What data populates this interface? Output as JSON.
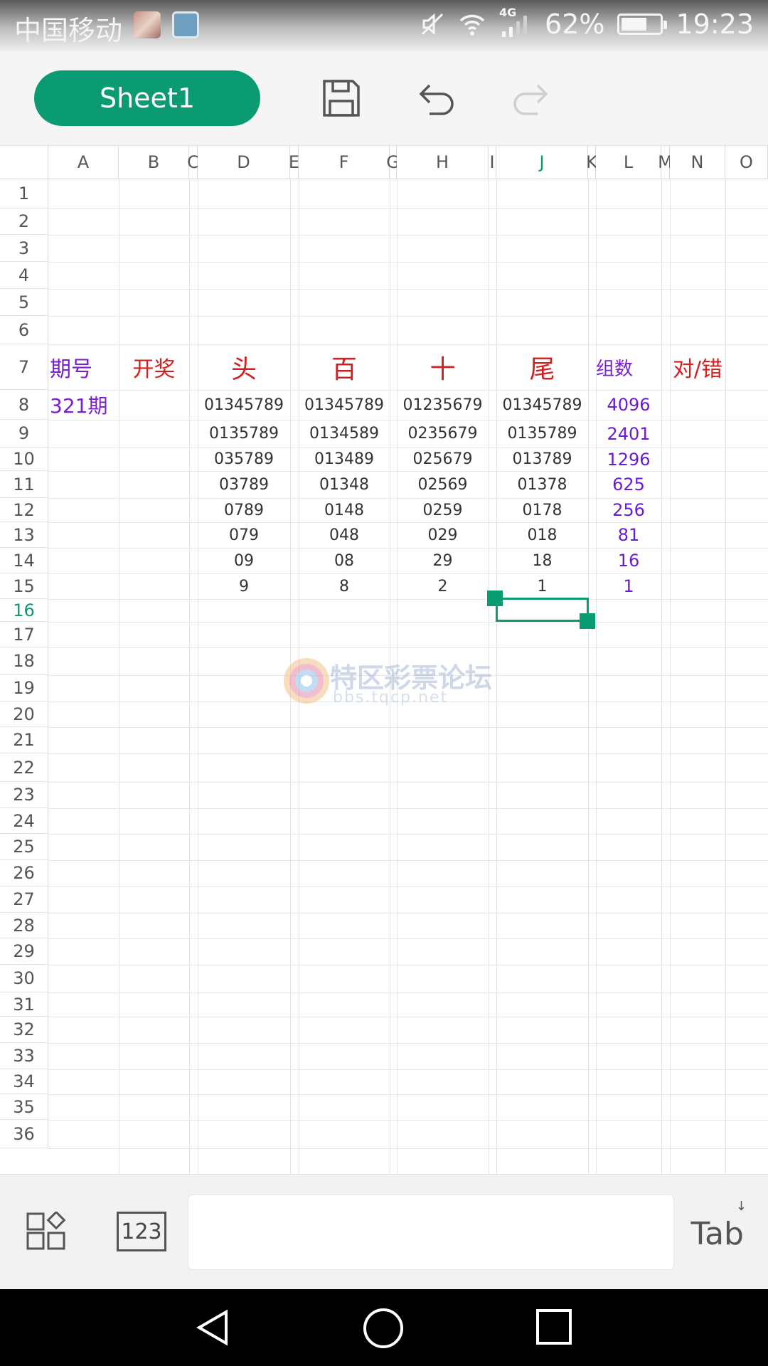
{
  "status": {
    "carrier": "中国移动",
    "network": "4G",
    "battery": "62%",
    "time": "19:23"
  },
  "toolbar": {
    "sheet_label": "Sheet1",
    "save_icon": "save-icon",
    "undo_icon": "undo-icon",
    "redo_icon": "redo-icon"
  },
  "columns": [
    "A",
    "B",
    "C",
    "D",
    "E",
    "F",
    "G",
    "H",
    "I",
    "J",
    "K",
    "L",
    "M",
    "N",
    "O"
  ],
  "selected_column": "J",
  "rows": [
    "1",
    "2",
    "3",
    "4",
    "5",
    "6",
    "7",
    "8",
    "9",
    "10",
    "11",
    "12",
    "13",
    "14",
    "15",
    "16",
    "17",
    "18",
    "19",
    "20",
    "21",
    "22",
    "23",
    "24",
    "25",
    "26",
    "27",
    "28",
    "29",
    "30",
    "31",
    "32",
    "33",
    "34",
    "35",
    "36"
  ],
  "selected_row": "16",
  "headers": {
    "period": "期号",
    "draw": "开奖",
    "head": "头",
    "hundred": "百",
    "ten": "十",
    "tail": "尾",
    "count": "组数",
    "right_wrong": "对/错"
  },
  "period_value": "321期",
  "table": [
    {
      "head": "01345789",
      "hundred": "01345789",
      "ten": "01235679",
      "tail": "01345789",
      "count": "4096"
    },
    {
      "head": "0135789",
      "hundred": "0134589",
      "ten": "0235679",
      "tail": "0135789",
      "count": "2401"
    },
    {
      "head": "035789",
      "hundred": "013489",
      "ten": "025679",
      "tail": "013789",
      "count": "1296"
    },
    {
      "head": "03789",
      "hundred": "01348",
      "ten": "02569",
      "tail": "01378",
      "count": "625"
    },
    {
      "head": "0789",
      "hundred": "0148",
      "ten": "0259",
      "tail": "0178",
      "count": "256"
    },
    {
      "head": "079",
      "hundred": "048",
      "ten": "029",
      "tail": "018",
      "count": "81"
    },
    {
      "head": "09",
      "hundred": "08",
      "ten": "29",
      "tail": "18",
      "count": "16"
    },
    {
      "head": "9",
      "hundred": "8",
      "ten": "2",
      "tail": "1",
      "count": "1"
    }
  ],
  "watermark": {
    "title": "特区彩票论坛",
    "url": "bbs.tqcp.net"
  },
  "input_bar": {
    "apps_icon": "apps-icon",
    "numeric_label": "123",
    "formula_value": "",
    "tab_label": "Tab"
  },
  "nav": {
    "back_icon": "back-icon",
    "home_icon": "home-icon",
    "recents_icon": "recents-icon"
  },
  "colors": {
    "accent": "#0a9b72",
    "red_header": "#d31f1f",
    "purple": "#7a1fd1"
  }
}
